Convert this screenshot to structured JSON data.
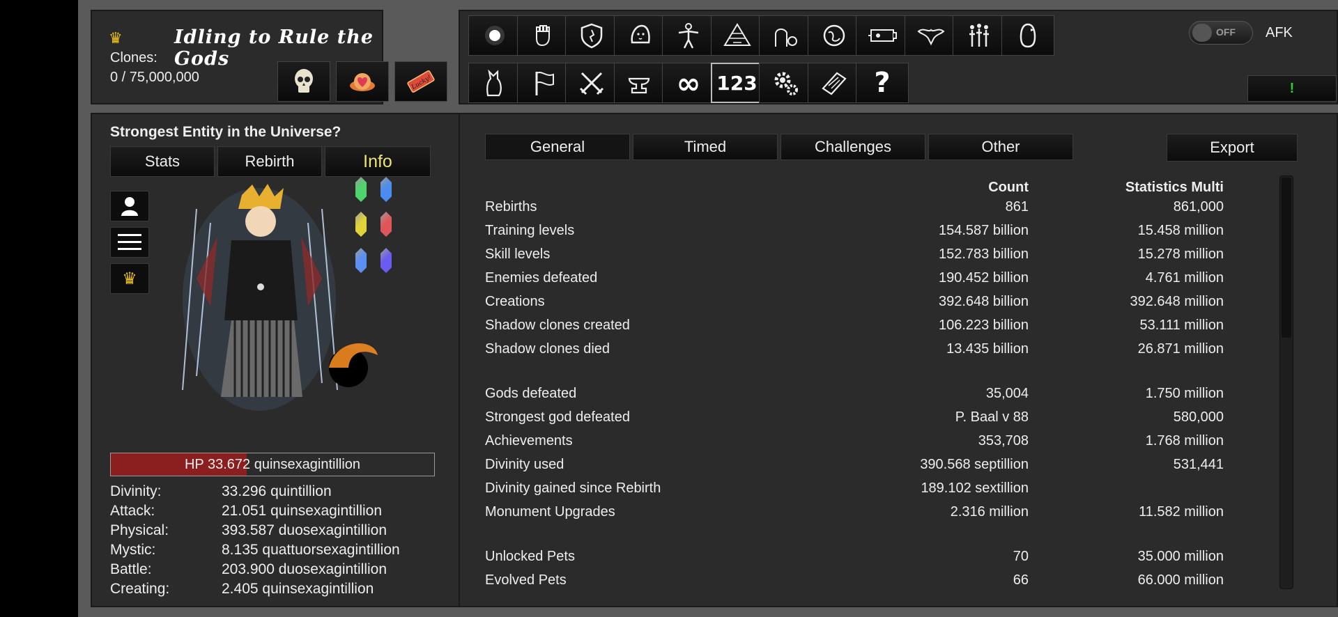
{
  "header": {
    "game_title": "Idling to Rule the Gods",
    "clones_label": "Clones:",
    "clones_value": "0 / 75,000,000"
  },
  "header_icons": [
    "skull-icon",
    "lotus-heart-icon",
    "lucky-ticket-icon"
  ],
  "lucky_ticket_text": "Lucky!",
  "toolbar_row1": [
    "light-orb-icon",
    "fist-icon",
    "shield-icon",
    "ghost-blob-icon",
    "body-silhouette-icon",
    "pyramid-icon",
    "washroom-icon",
    "globe-icon",
    "ship-icon",
    "dragon-icon",
    "family-icon",
    "penguin-icon"
  ],
  "toolbar_row2": [
    "cat-icon",
    "flag-icon",
    "crossed-swords-icon",
    "anvil-icon",
    "infinity-icon",
    "number-123-icon",
    "gears-icon",
    "book-icon",
    "question-icon"
  ],
  "toolbar_labels": {
    "infinity": "∞",
    "numbers": "123",
    "question": "?"
  },
  "afk": {
    "toggle_text": "OFF",
    "toggle_state": "off",
    "label": "AFK"
  },
  "alert_button": "!",
  "left": {
    "title": "Strongest Entity in the Universe?",
    "tabs": [
      "Stats",
      "Rebirth",
      "Info"
    ],
    "active_tab": "Info",
    "side_buttons": [
      "person-icon",
      "menu-icon",
      "crown-icon"
    ],
    "gem_colors": [
      "#4fd36b",
      "#4a8cf0",
      "#e0d33a",
      "#e0555a",
      "#5c8ff2",
      "#6a5cf0"
    ],
    "hp_text": "HP 33.672 quinsexagintillion",
    "hp_fraction": 0.42,
    "stats": [
      {
        "label": "Divinity:",
        "value": "33.296 quintillion"
      },
      {
        "label": "Attack:",
        "value": "21.051 quinsexagintillion"
      },
      {
        "label": "Physical:",
        "value": "393.587 duosexagintillion"
      },
      {
        "label": "Mystic:",
        "value": "8.135 quattuorsexagintillion"
      },
      {
        "label": "Battle:",
        "value": "203.900 duosexagintillion"
      },
      {
        "label": "Creating:",
        "value": "2.405 quinsexagintillion"
      }
    ]
  },
  "right": {
    "tabs": [
      "General",
      "Timed",
      "Challenges",
      "Other"
    ],
    "active_tab": "General",
    "export_label": "Export",
    "col_count": "Count",
    "col_multi": "Statistics Multi",
    "rows": [
      {
        "label": "Rebirths",
        "count": "861",
        "multi": "861,000"
      },
      {
        "label": "Training levels",
        "count": "154.587 billion",
        "multi": "15.458 million"
      },
      {
        "label": "Skill levels",
        "count": "152.783 billion",
        "multi": "15.278 million"
      },
      {
        "label": "Enemies defeated",
        "count": "190.452 billion",
        "multi": "4.761 million"
      },
      {
        "label": "Creations",
        "count": "392.648 billion",
        "multi": "392.648 million"
      },
      {
        "label": "Shadow clones created",
        "count": "106.223 billion",
        "multi": "53.111 million"
      },
      {
        "label": "Shadow clones died",
        "count": "13.435 billion",
        "multi": "26.871 million"
      },
      {
        "gap": true
      },
      {
        "label": "Gods defeated",
        "count": "35,004",
        "multi": "1.750 million"
      },
      {
        "label": "Strongest god defeated",
        "count": "P. Baal v 88",
        "multi": "580,000"
      },
      {
        "label": "Achievements",
        "count": "353,708",
        "multi": "1.768 million"
      },
      {
        "label": "Divinity used",
        "count": "390.568 septillion",
        "multi": "531,441"
      },
      {
        "label": "Divinity gained since Rebirth",
        "count": "189.102 sextillion",
        "multi": ""
      },
      {
        "label": "Monument Upgrades",
        "count": "2.316 million",
        "multi": "11.582 million"
      },
      {
        "gap": true
      },
      {
        "label": "Unlocked Pets",
        "count": "70",
        "multi": "35.000 million"
      },
      {
        "label": "Evolved Pets",
        "count": "66",
        "multi": "66.000 million"
      }
    ]
  }
}
